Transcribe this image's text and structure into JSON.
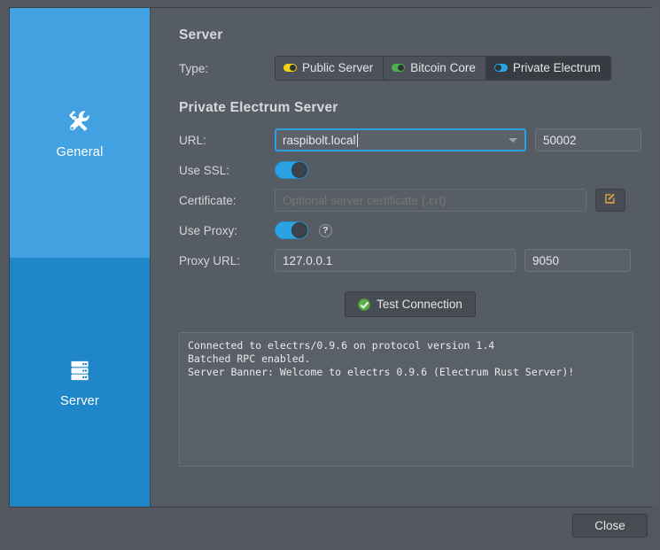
{
  "sidebar": {
    "items": [
      {
        "label": "General",
        "icon": "tools-icon",
        "selected": false
      },
      {
        "label": "Server",
        "icon": "server-rack-icon",
        "selected": true
      }
    ]
  },
  "server_section": {
    "title": "Server",
    "type_label": "Type:",
    "type_options": [
      {
        "label": "Public Server",
        "toggle_color": "#f5d213",
        "selected": false
      },
      {
        "label": "Bitcoin Core",
        "toggle_color": "#4caf50",
        "selected": false
      },
      {
        "label": "Private Electrum",
        "toggle_color": "#29a3e3",
        "selected": true
      }
    ]
  },
  "private_electrum": {
    "title": "Private Electrum Server",
    "url_label": "URL:",
    "url_value": "raspibolt.local",
    "port_value": "50002",
    "ssl_label": "Use SSL:",
    "ssl_enabled": "true",
    "certificate_label": "Certificate:",
    "certificate_value": "",
    "certificate_placeholder": "Optional server certificate (.crt)",
    "proxy_label": "Use Proxy:",
    "proxy_enabled": "true",
    "proxy_help": "?",
    "proxy_url_label": "Proxy URL:",
    "proxy_url_value": "127.0.0.1",
    "proxy_port_value": "9050"
  },
  "test": {
    "button_label": "Test Connection",
    "icon": "check-circle-icon"
  },
  "log": {
    "text": "Connected to electrs/0.9.6 on protocol version 1.4\nBatched RPC enabled.\nServer Banner: Welcome to electrs 0.9.6 (Electrum Rust Server)!"
  },
  "footer": {
    "close_label": "Close"
  },
  "colors": {
    "accent_blue": "#29a3e3",
    "sidebar_blue": "#42a1e0",
    "sidebar_selected_blue": "#1f86ca",
    "panel_gray": "#565c63",
    "window_gray": "#53585f",
    "success_green": "#5fae4a",
    "public_yellow": "#f5d213"
  }
}
